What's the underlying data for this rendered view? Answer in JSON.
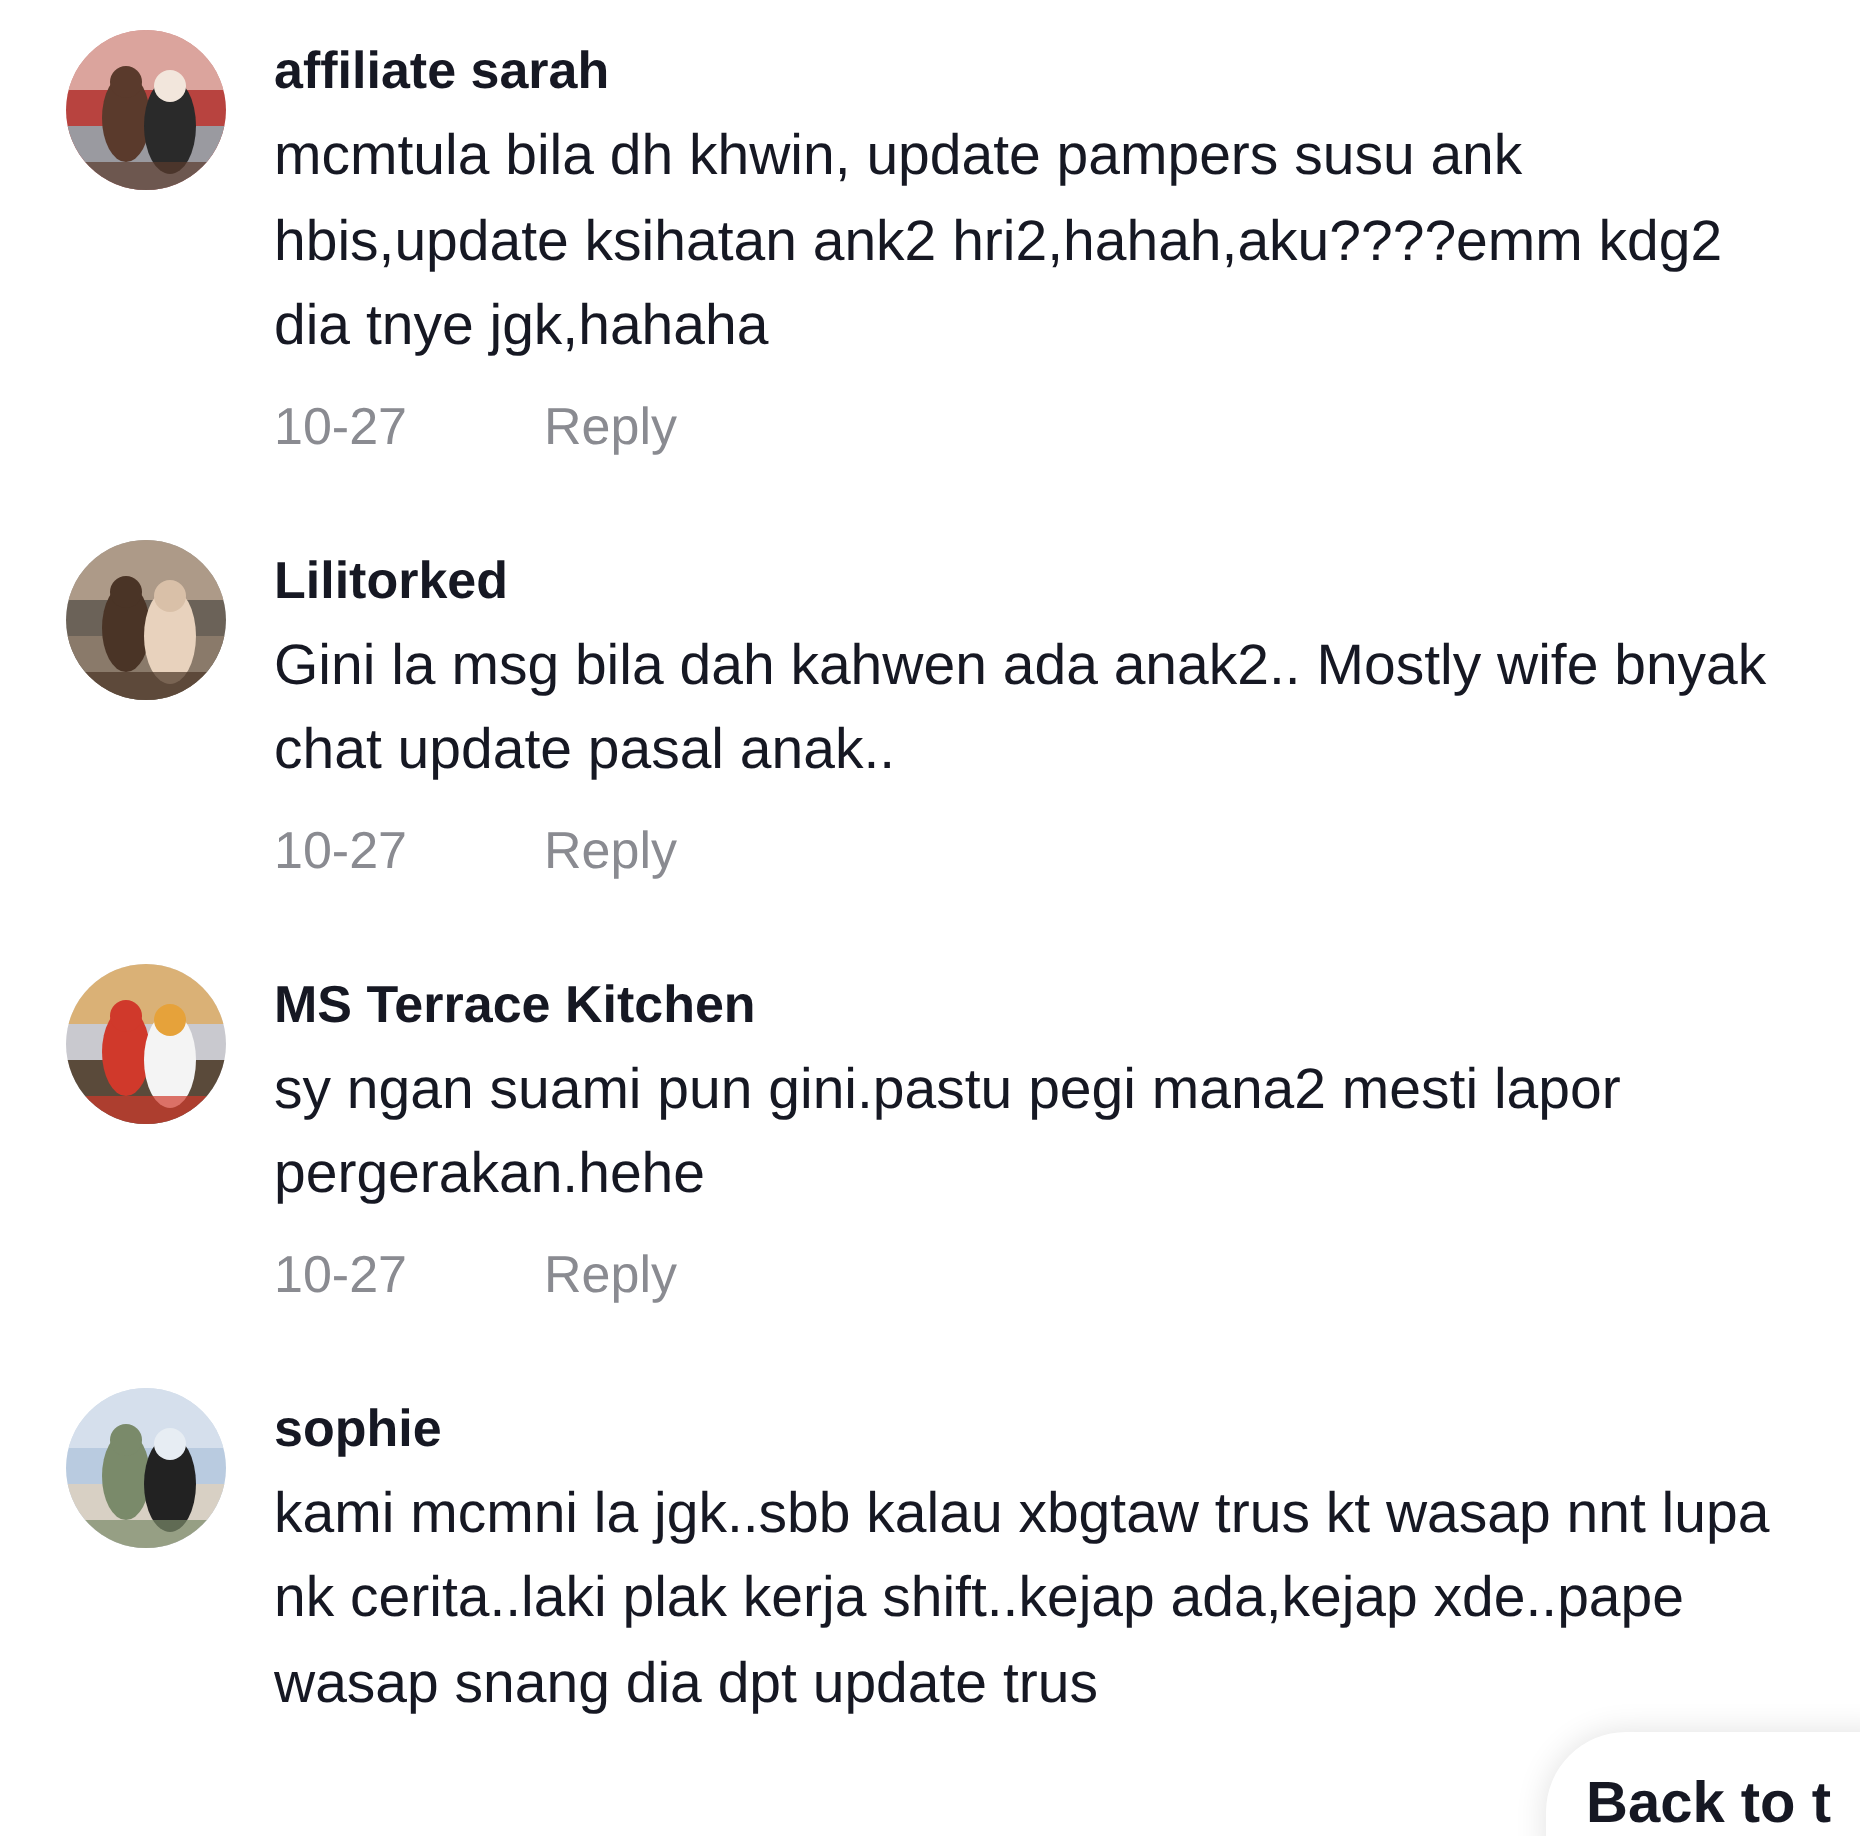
{
  "comments": [
    {
      "name": "affiliate sarah",
      "text": "mcmtula bila dh khwin, update pampers susu ank hbis,update ksihatan ank2 hri2,hahah,aku????emm kdg2 dia tnye jgk,hahaha",
      "date": "10-27",
      "reply": "Reply"
    },
    {
      "name": "Lilitorked",
      "text": "Gini la msg bila dah kahwen ada anak2.. Mostly wife bnyak chat update pasal anak..",
      "date": "10-27",
      "reply": "Reply"
    },
    {
      "name": "MS Terrace Kitchen",
      "text": "sy ngan suami pun gini.pastu pegi mana2 mesti lapor pergerakan.hehe",
      "date": "10-27",
      "reply": "Reply"
    },
    {
      "name": "sophie",
      "text": "kami mcmni la jgk..sbb kalau xbgtaw trus kt wasap nnt lupa nk cerita..laki plak kerja shift..kejap ada,kejap xde..pape wasap snang dia dpt update trus"
    }
  ],
  "back_button": {
    "label": "Back to t"
  }
}
